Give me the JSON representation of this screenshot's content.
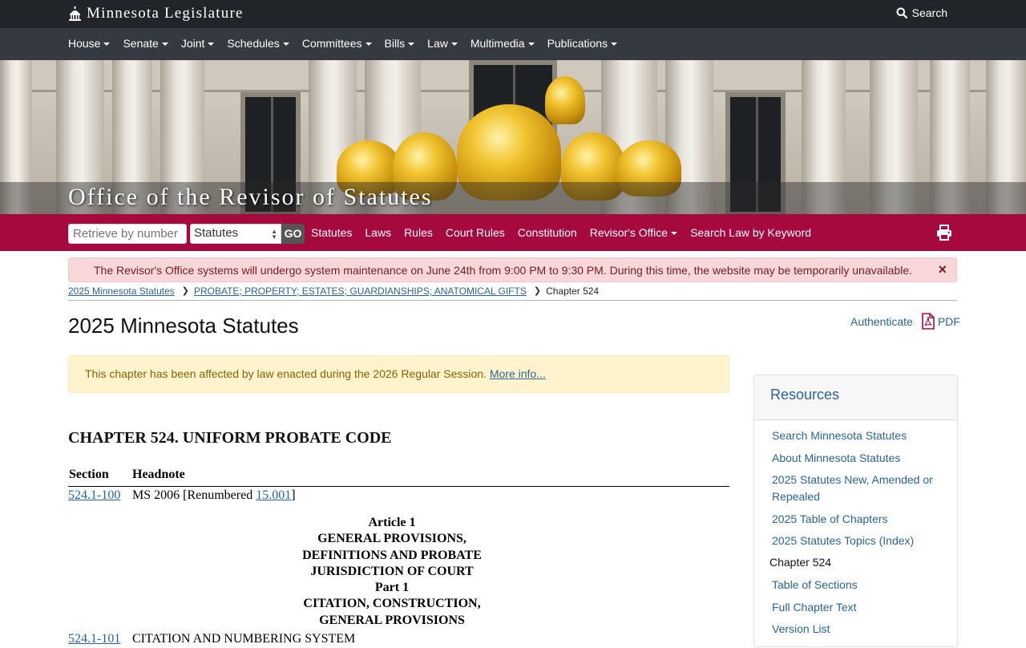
{
  "header": {
    "brand": "Minnesota Legislature",
    "search_label": "Search"
  },
  "mainnav": [
    "House",
    "Senate",
    "Joint",
    "Schedules",
    "Committees",
    "Bills",
    "Law",
    "Multimedia",
    "Publications"
  ],
  "banner": {
    "title": "Office of the Revisor of Statutes"
  },
  "revbar": {
    "retrieve_placeholder": "Retrieve by number",
    "select_value": "Statutes",
    "go_label": "GO",
    "links": [
      {
        "label": "Statutes",
        "dropdown": false
      },
      {
        "label": "Laws",
        "dropdown": false
      },
      {
        "label": "Rules",
        "dropdown": false
      },
      {
        "label": "Court Rules",
        "dropdown": false
      },
      {
        "label": "Constitution",
        "dropdown": false
      },
      {
        "label": "Revisor's Office",
        "dropdown": true
      },
      {
        "label": "Search Law by Keyword",
        "dropdown": false
      }
    ]
  },
  "alert": {
    "message": "The Revisor's Office systems will undergo system maintenance on June 24th from 9:00 PM to 9:30 PM. During this time, the website may be temporarily unavailable.",
    "close": "×"
  },
  "breadcrumb": {
    "item1": "2025 Minnesota Statutes",
    "item2": "PROBATE; PROPERTY; ESTATES; GUARDIANSHIPS; ANATOMICAL GIFTS",
    "current": "Chapter 524"
  },
  "page_title": "2025 Minnesota Statutes",
  "auth": {
    "authenticate": "Authenticate",
    "pdf": "PDF"
  },
  "notice": {
    "text": "This chapter has been affected by law enacted during the 2026 Regular Session.",
    "link": "More info..."
  },
  "chapter_title": "CHAPTER 524. UNIFORM PROBATE CODE",
  "table": {
    "col_section": "Section",
    "col_headnote": "Headnote",
    "row1": {
      "section": "524.1-100",
      "headnote_pre": "MS 2006 [Renumbered ",
      "headnote_link": "15.001",
      "headnote_post": "]"
    },
    "article_lines": [
      "Article 1",
      "GENERAL PROVISIONS,",
      "DEFINITIONS AND PROBATE",
      "JURISDICTION OF COURT",
      "Part 1",
      "CITATION, CONSTRUCTION,",
      "GENERAL PROVISIONS"
    ],
    "row2": {
      "section": "524.1-101",
      "headnote": "CITATION AND NUMBERING SYSTEM"
    }
  },
  "resources": {
    "title": "Resources",
    "links": [
      "Search Minnesota Statutes",
      "About Minnesota Statutes",
      "2025 Statutes New, Amended or Repealed",
      "2025 Table of Chapters",
      "2025 Statutes Topics (Index)"
    ],
    "chapter_heading": "Chapter 524",
    "chapter_links": [
      "Table of Sections",
      "Full Chapter Text",
      "Version List"
    ]
  },
  "colors": {
    "topbar": "#212529",
    "nav": "#343a40",
    "revbar": "#a6093d",
    "link": "#2a6496"
  }
}
